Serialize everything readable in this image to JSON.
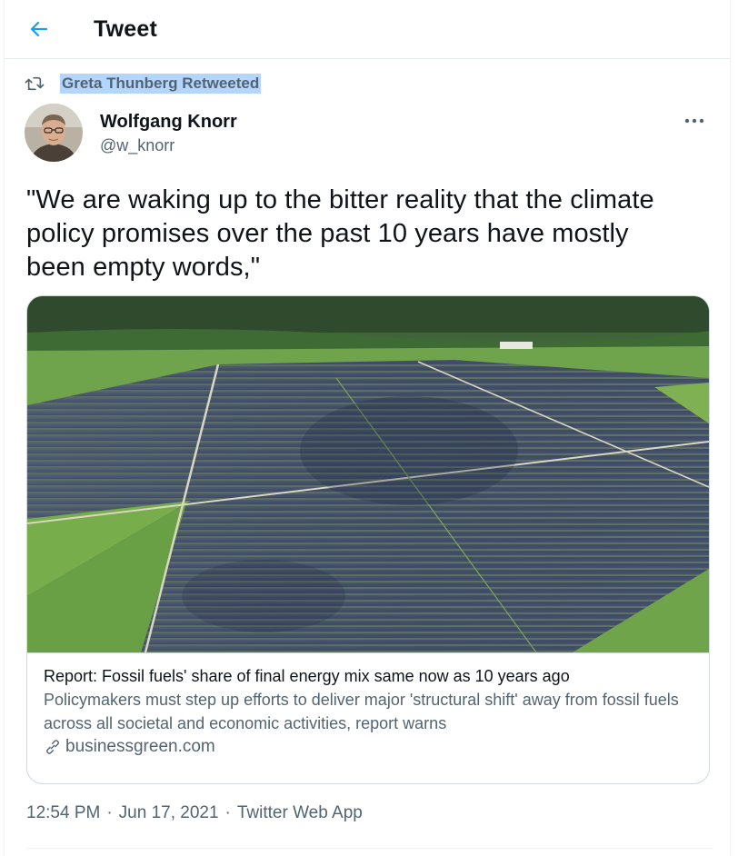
{
  "header": {
    "title": "Tweet",
    "back_icon": "back-arrow-icon",
    "accent_color": "#1d9bf0"
  },
  "social_context": {
    "icon": "retweet-icon",
    "label": "Greta Thunberg Retweeted"
  },
  "author": {
    "display_name": "Wolfgang Knorr",
    "handle": "@w_knorr"
  },
  "tweet": {
    "text": "\"We are waking up to the bitter reality that the climate\npolicy promises over the past 10 years have mostly\nbeen empty words,\""
  },
  "card": {
    "title": "Report: Fossil fuels' share of final energy mix same now as 10 years ago",
    "description": "Policymakers must step up efforts to deliver major 'structural shift' away from fossil fuels across all societal and economic activities, report warns",
    "domain": "businessgreen.com",
    "link_icon": "link-icon"
  },
  "meta": {
    "time": "12:54 PM",
    "date": "Jun 17, 2021",
    "separator": "·",
    "source": "Twitter Web App"
  }
}
